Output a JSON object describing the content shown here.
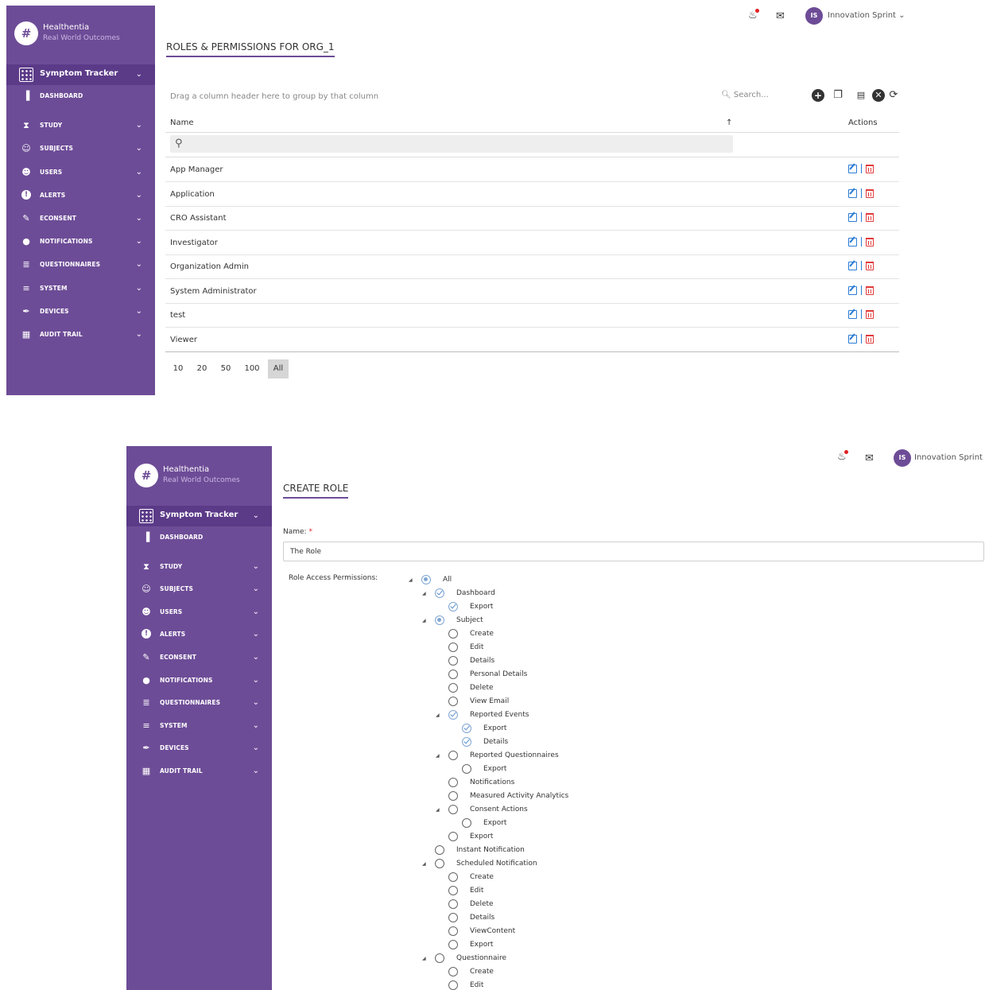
{
  "brand": {
    "name": "Healthentia",
    "subtitle": "Real World Outcomes",
    "logo": "#"
  },
  "app_selector": {
    "label": "Symptom Tracker"
  },
  "nav": [
    {
      "id": "dashboard",
      "label": "DASHBOARD",
      "icon": "bar-chart-icon",
      "has_chevron": false
    },
    {
      "id": "study",
      "label": "STUDY",
      "icon": "hourglass-icon",
      "has_chevron": true
    },
    {
      "id": "subjects",
      "label": "SUBJECTS",
      "icon": "users-icon",
      "has_chevron": true
    },
    {
      "id": "users",
      "label": "USERS",
      "icon": "user-icon",
      "has_chevron": true
    },
    {
      "id": "alerts",
      "label": "ALERTS",
      "icon": "alert-icon",
      "has_chevron": true
    },
    {
      "id": "econsent",
      "label": "ECONSENT",
      "icon": "pencil-icon",
      "has_chevron": true
    },
    {
      "id": "notifications",
      "label": "NOTIFICATIONS",
      "icon": "chat-icon",
      "has_chevron": true
    },
    {
      "id": "questionnaires",
      "label": "QUESTIONNAIRES",
      "icon": "list-icon",
      "has_chevron": true
    },
    {
      "id": "system",
      "label": "SYSTEM",
      "icon": "sliders-icon",
      "has_chevron": true
    },
    {
      "id": "devices",
      "label": "DEVICES",
      "icon": "plug-icon",
      "has_chevron": true
    },
    {
      "id": "audit-trail",
      "label": "AUDIT TRAIL",
      "icon": "audit-icon",
      "has_chevron": true
    }
  ],
  "header": {
    "user_initials": "IS",
    "user_name": "Innovation Sprint",
    "chevron": "⌄"
  },
  "roles_page": {
    "title": "ROLES & PERMISSIONS FOR ORG_1",
    "group_hint": "Drag a column header here to group by that column",
    "search_placeholder": "Search...",
    "columns": {
      "name": "Name",
      "sort_indicator": "↑",
      "actions": "Actions"
    },
    "roles": [
      "App Manager",
      "Application",
      "CRO Assistant",
      "Investigator",
      "Organization Admin",
      "System Administrator",
      "test",
      "Viewer"
    ],
    "page_sizes": [
      "10",
      "20",
      "50",
      "100",
      "All"
    ],
    "selected_page_size": "All"
  },
  "create_role": {
    "title": "CREATE ROLE",
    "name_label": "Name:",
    "required_mark": "*",
    "name_value": "The Role",
    "permissions_label": "Role Access Permissions:",
    "tree": [
      {
        "label": "All",
        "level": 0,
        "expanded": true,
        "state": "partial"
      },
      {
        "label": "Dashboard",
        "level": 1,
        "expanded": true,
        "state": "checked"
      },
      {
        "label": "Export",
        "level": 2,
        "state": "checked"
      },
      {
        "label": "Subject",
        "level": 1,
        "expanded": true,
        "state": "partial"
      },
      {
        "label": "Create",
        "level": 2,
        "state": "unchecked"
      },
      {
        "label": "Edit",
        "level": 2,
        "state": "unchecked"
      },
      {
        "label": "Details",
        "level": 2,
        "state": "unchecked"
      },
      {
        "label": "Personal Details",
        "level": 2,
        "state": "unchecked"
      },
      {
        "label": "Delete",
        "level": 2,
        "state": "unchecked"
      },
      {
        "label": "View Email",
        "level": 2,
        "state": "unchecked"
      },
      {
        "label": "Reported Events",
        "level": 2,
        "expanded": true,
        "state": "checked"
      },
      {
        "label": "Export",
        "level": 3,
        "state": "checked"
      },
      {
        "label": "Details",
        "level": 3,
        "state": "checked"
      },
      {
        "label": "Reported Questionnaires",
        "level": 2,
        "expanded": true,
        "state": "unchecked"
      },
      {
        "label": "Export",
        "level": 3,
        "state": "unchecked"
      },
      {
        "label": "Notifications",
        "level": 2,
        "state": "unchecked"
      },
      {
        "label": "Measured Activity Analytics",
        "level": 2,
        "state": "unchecked"
      },
      {
        "label": "Consent Actions",
        "level": 2,
        "expanded": true,
        "state": "unchecked"
      },
      {
        "label": "Export",
        "level": 3,
        "state": "unchecked"
      },
      {
        "label": "Export",
        "level": 2,
        "state": "unchecked"
      },
      {
        "label": "Instant Notification",
        "level": 1,
        "state": "unchecked"
      },
      {
        "label": "Scheduled Notification",
        "level": 1,
        "expanded": true,
        "state": "unchecked"
      },
      {
        "label": "Create",
        "level": 2,
        "state": "unchecked"
      },
      {
        "label": "Edit",
        "level": 2,
        "state": "unchecked"
      },
      {
        "label": "Delete",
        "level": 2,
        "state": "unchecked"
      },
      {
        "label": "Details",
        "level": 2,
        "state": "unchecked"
      },
      {
        "label": "ViewContent",
        "level": 2,
        "state": "unchecked"
      },
      {
        "label": "Export",
        "level": 2,
        "state": "unchecked"
      },
      {
        "label": "Questionnaire",
        "level": 1,
        "expanded": true,
        "state": "unchecked"
      },
      {
        "label": "Create",
        "level": 2,
        "state": "unchecked"
      },
      {
        "label": "Edit",
        "level": 2,
        "state": "unchecked"
      }
    ]
  },
  "colors": {
    "sidebar": "#6d4c97",
    "sidebar_active": "#5b3a88",
    "accent": "#6d4c97",
    "edit": "#2b7cd3",
    "delete": "#e23a3a",
    "check": "#5a8fce"
  }
}
